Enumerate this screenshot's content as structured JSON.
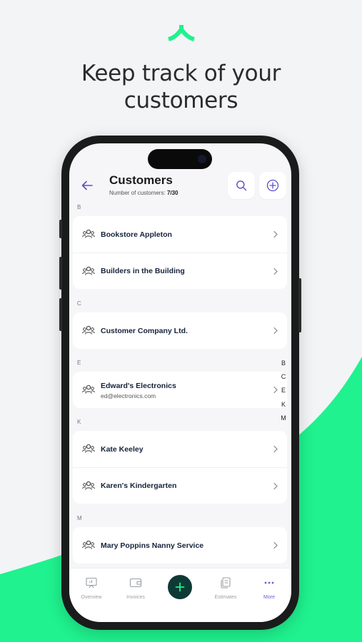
{
  "promo": {
    "headline_line1": "Keep track of your",
    "headline_line2": "customers",
    "brand_color": "#1ff28e"
  },
  "header": {
    "title": "Customers",
    "subtitle_label": "Number of customers:",
    "subtitle_count": "7/30",
    "back_icon": "arrow-left-icon",
    "search_icon": "search-icon",
    "add_icon": "plus-circle-icon"
  },
  "sections": [
    {
      "letter": "B",
      "customers": [
        {
          "name": "Bookstore Appleton"
        },
        {
          "name": "Builders in the Building"
        }
      ]
    },
    {
      "letter": "C",
      "customers": [
        {
          "name": "Customer Company Ltd."
        }
      ]
    },
    {
      "letter": "E",
      "customers": [
        {
          "name": "Edward's Electronics",
          "email": "ed@electronics.com"
        }
      ]
    },
    {
      "letter": "K",
      "customers": [
        {
          "name": "Kate Keeley"
        },
        {
          "name": "Karen's Kindergarten"
        }
      ]
    },
    {
      "letter": "M",
      "customers": [
        {
          "name": "Mary Poppins Nanny Service"
        }
      ]
    }
  ],
  "alpha_index": [
    "B",
    "C",
    "E",
    "K",
    "M"
  ],
  "tabbar": {
    "overview": "Overview",
    "invoices": "Invoices",
    "estimates": "Estimates",
    "more": "More",
    "active": "More",
    "accent_color": "#6b5fd3"
  }
}
